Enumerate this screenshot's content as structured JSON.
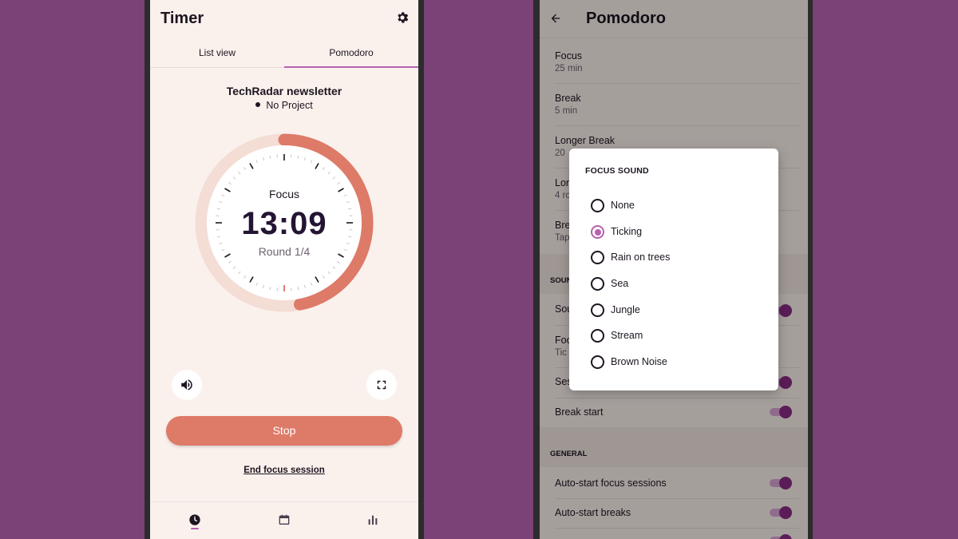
{
  "colors": {
    "background": "#7a4277",
    "screen": "#faf1ed",
    "accent": "#b561b0",
    "progress": "#de7a68",
    "progress_track": "#f4ddd5",
    "toggle_knob": "#8a2d86"
  },
  "timer_screen": {
    "title": "Timer",
    "settings_icon": "gear-icon",
    "tabs": [
      {
        "label": "List view",
        "active": false
      },
      {
        "label": "Pomodoro",
        "active": true
      }
    ],
    "task_name": "TechRadar newsletter",
    "project": "No Project",
    "dial": {
      "mode_label": "Focus",
      "time": "13:09",
      "round_label": "Round 1/4",
      "progress_fraction": 0.47
    },
    "volume_icon": "volume-icon",
    "fullscreen_icon": "fullscreen-icon",
    "stop_label": "Stop",
    "end_session_label": "End focus session",
    "bottom_nav": [
      {
        "icon": "clock-icon",
        "active": true
      },
      {
        "icon": "calendar-icon",
        "active": false
      },
      {
        "icon": "bar-chart-icon",
        "active": false
      }
    ]
  },
  "pomodoro_settings": {
    "title": "Pomodoro",
    "back_icon": "arrow-left-icon",
    "items": [
      {
        "title": "Focus",
        "subtitle": "25 min"
      },
      {
        "title": "Break",
        "subtitle": "5 min"
      },
      {
        "title": "Longer Break",
        "subtitle": "20"
      },
      {
        "title": "Lon",
        "subtitle": "4 ro"
      },
      {
        "title": "Bre",
        "subtitle": "Tap"
      }
    ],
    "sound_section_label": "SOUN",
    "sound_items": [
      {
        "title": "Sou",
        "subtitle": ""
      },
      {
        "title": "Foc",
        "subtitle": "Tic"
      },
      {
        "title": "Ses",
        "subtitle": ""
      },
      {
        "title": "Break start",
        "subtitle": ""
      }
    ],
    "general_section_label": "GENERAL",
    "general_items": [
      {
        "title": "Auto-start focus sessions"
      },
      {
        "title": "Auto-start breaks"
      }
    ]
  },
  "focus_sound_dialog": {
    "title": "FOCUS SOUND",
    "options": [
      "None",
      "Ticking",
      "Rain on trees",
      "Sea",
      "Jungle",
      "Stream",
      "Brown Noise"
    ],
    "selected": "Ticking"
  }
}
